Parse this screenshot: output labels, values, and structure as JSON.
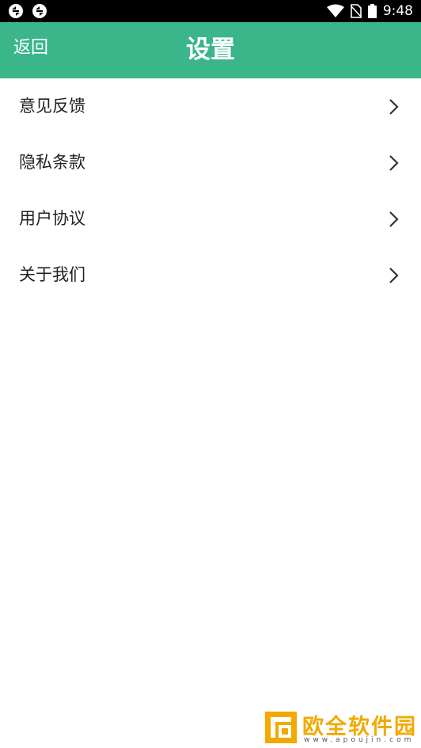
{
  "status_bar": {
    "time": "9:48",
    "left_icons": [
      "app-notification-icon",
      "app-notification-icon"
    ],
    "right_icons": [
      "wifi-icon",
      "no-sim-icon",
      "battery-icon"
    ]
  },
  "header": {
    "back_label": "返回",
    "title": "设置",
    "background_color": "#3bb58a"
  },
  "menu": {
    "items": [
      {
        "label": "意见反馈",
        "icon": "chevron-right-icon"
      },
      {
        "label": "隐私条款",
        "icon": "chevron-right-icon"
      },
      {
        "label": "用户协议",
        "icon": "chevron-right-icon"
      },
      {
        "label": "关于我们",
        "icon": "chevron-right-icon"
      }
    ]
  },
  "watermark": {
    "text": "欧全软件园",
    "url": "www.apoujin.com"
  }
}
